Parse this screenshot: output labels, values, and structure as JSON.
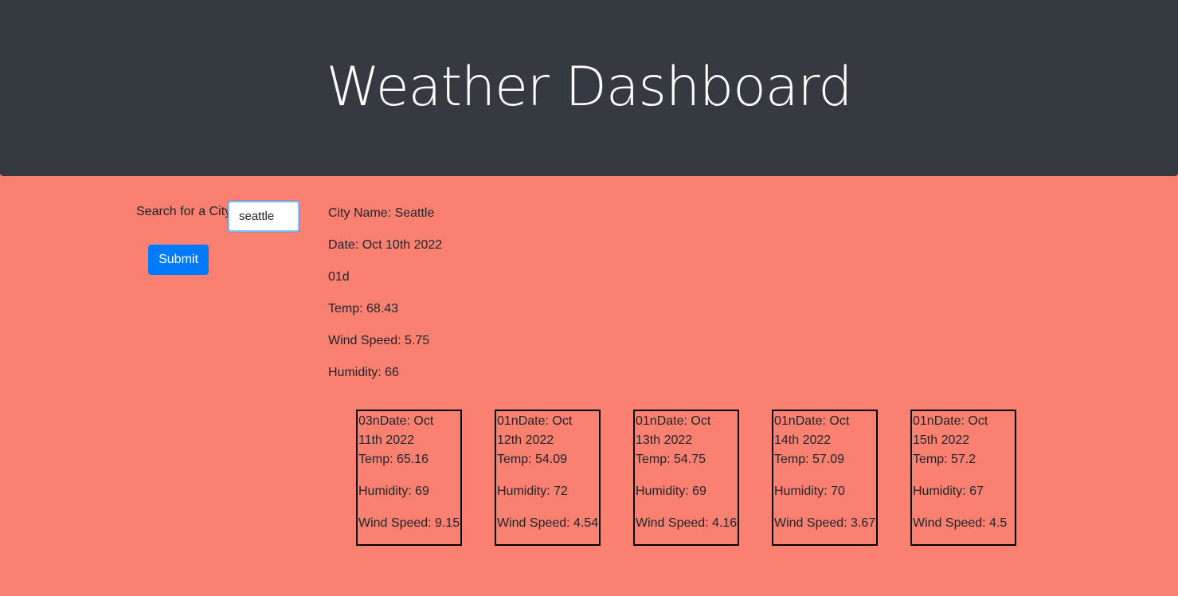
{
  "header": {
    "title": "Weather Dashboard"
  },
  "search": {
    "label": "Search for a City",
    "value": "seattle",
    "submit_label": "Submit"
  },
  "current": {
    "city": "City Name: Seattle",
    "date": "Date: Oct 10th 2022",
    "icon_code": "01d",
    "temp": "Temp: 68.43",
    "wind": "Wind Speed: 5.75",
    "humidity": "Humidity: 66"
  },
  "forecast": [
    {
      "head": "03nDate: Oct 11th 2022",
      "temp": "Temp: 65.16",
      "humidity": "Humidity: 69",
      "wind": "Wind Speed: 9.15"
    },
    {
      "head": "01nDate: Oct 12th 2022",
      "temp": "Temp: 54.09",
      "humidity": "Humidity: 72",
      "wind": "Wind Speed: 4.54"
    },
    {
      "head": "01nDate: Oct 13th 2022",
      "temp": "Temp: 54.75",
      "humidity": "Humidity: 69",
      "wind": "Wind Speed: 4.16"
    },
    {
      "head": "01nDate: Oct 14th 2022",
      "temp": "Temp: 57.09",
      "humidity": "Humidity: 70",
      "wind": "Wind Speed: 3.67"
    },
    {
      "head": "01nDate: Oct 15th 2022",
      "temp": "Temp: 57.2",
      "humidity": "Humidity: 67",
      "wind": "Wind Speed: 4.5"
    }
  ],
  "colors": {
    "header_bg": "#343a40",
    "page_bg": "#fa8072",
    "button_bg": "#007bff"
  }
}
